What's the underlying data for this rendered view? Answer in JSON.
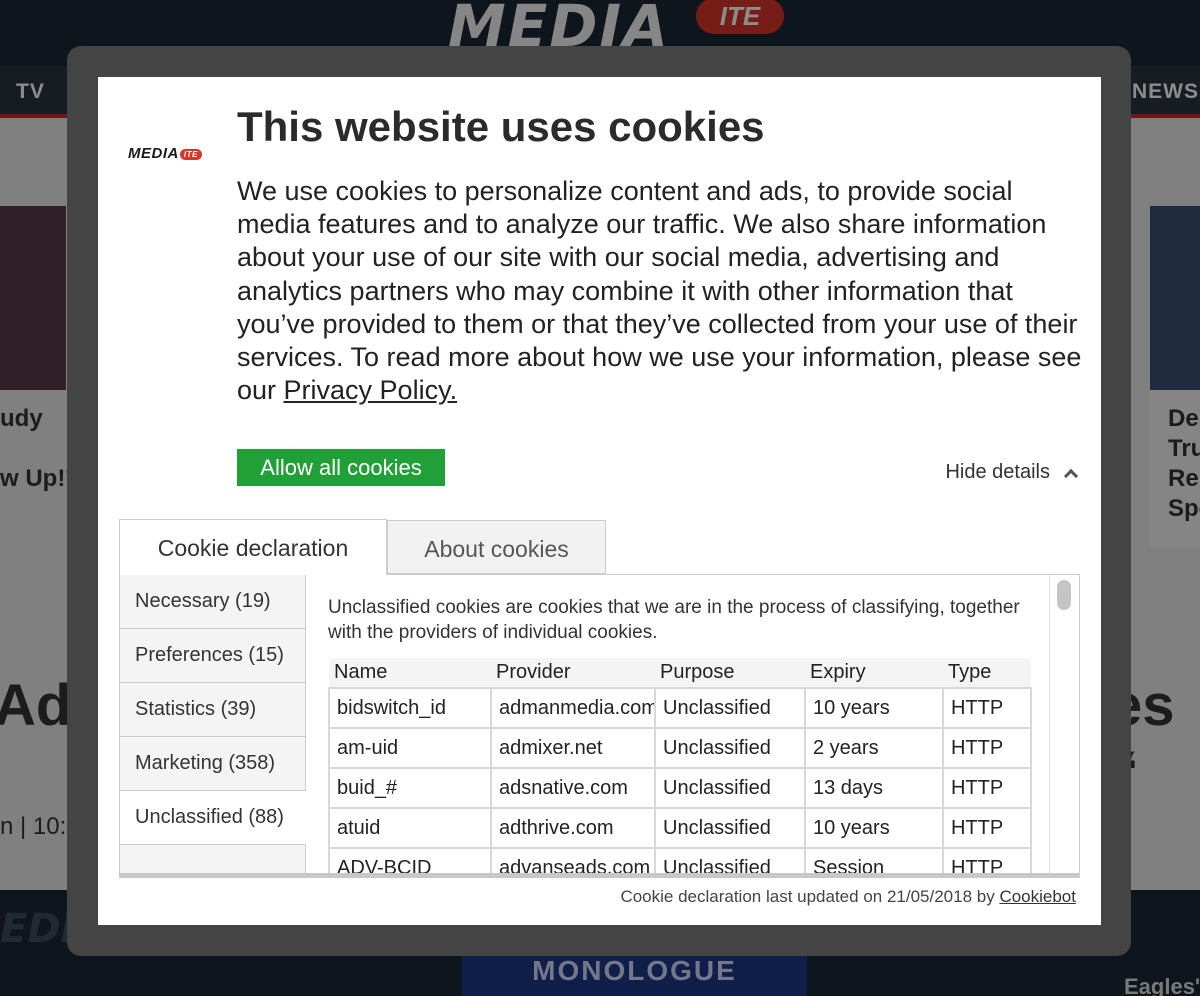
{
  "background": {
    "logo_text": "MEDIA",
    "logo_badge": "ITE",
    "nav_left": "TV",
    "nav_right": "NEWS",
    "snippet_left_1": "udy",
    "snippet_left_2": "w Up!'",
    "snippet_right": [
      "De",
      "Tru",
      "Re",
      "Spe"
    ],
    "big_left": "Adv",
    "big_right": "es “",
    "byline": "n | 10:",
    "footer_logo": "EDI",
    "banner_text": "MONOLOGUE",
    "eagles_text": "Eagles'"
  },
  "dialog": {
    "logo_text": "MEDIA",
    "logo_badge": "ITE",
    "title": "This website uses cookies",
    "body": "We use cookies to personalize content and ads, to provide social media features and to analyze our traffic. We also share information about your use of our site with our social media, advertising and analytics partners who may combine it with other information that you’ve provided to them or that they’ve collected from your use of their services. To read more about how we use your information, please see our ",
    "privacy_link": "Privacy Policy.",
    "allow_button": "Allow all cookies",
    "hide_details": "Hide details",
    "tabs": [
      {
        "label": "Cookie declaration",
        "active": true
      },
      {
        "label": "About cookies",
        "active": false
      }
    ],
    "categories": [
      {
        "label": "Necessary (19)",
        "active": false
      },
      {
        "label": "Preferences (15)",
        "active": false
      },
      {
        "label": "Statistics (39)",
        "active": false
      },
      {
        "label": "Marketing (358)",
        "active": false
      },
      {
        "label": "Unclassified (88)",
        "active": true
      }
    ],
    "category_description": "Unclassified cookies are cookies that we are in the process of classifying, together with the providers of individual cookies.",
    "table": {
      "headers": [
        "Name",
        "Provider",
        "Purpose",
        "Expiry",
        "Type"
      ],
      "rows": [
        [
          "bidswitch_id",
          "admanmedia.com",
          "Unclassified",
          "10 years",
          "HTTP"
        ],
        [
          "am-uid",
          "admixer.net",
          "Unclassified",
          "2 years",
          "HTTP"
        ],
        [
          "buid_#",
          "adsnative.com",
          "Unclassified",
          "13 days",
          "HTTP"
        ],
        [
          "atuid",
          "adthrive.com",
          "Unclassified",
          "10 years",
          "HTTP"
        ],
        [
          "ADV-BCID",
          "advanseads.com",
          "Unclassified",
          "Session",
          "HTTP"
        ]
      ]
    },
    "footer_text": "Cookie declaration last updated on 21/05/2018 by ",
    "footer_link": "Cookiebot"
  }
}
